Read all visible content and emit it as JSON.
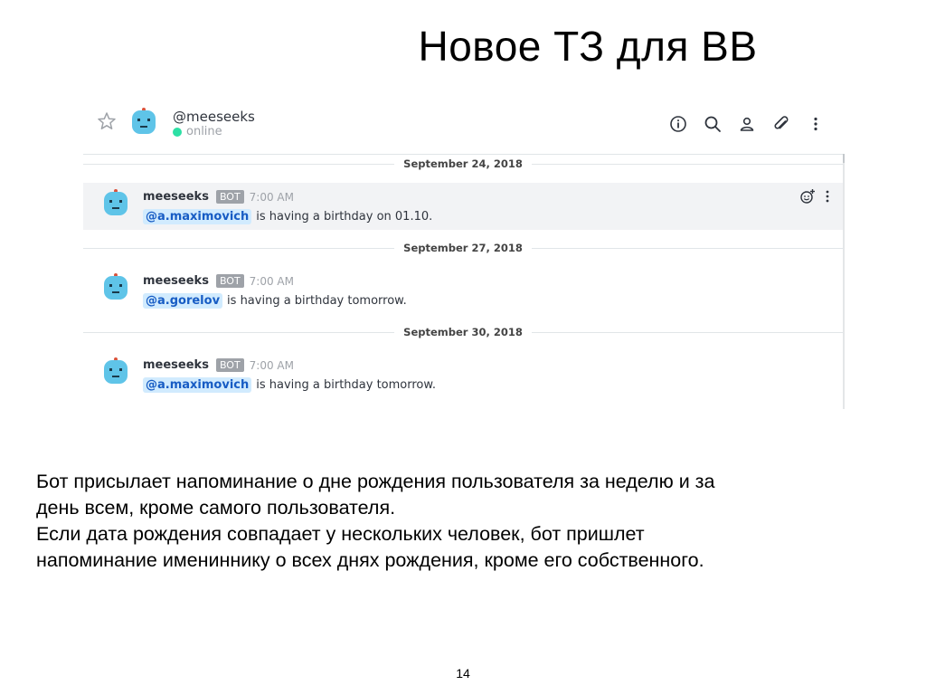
{
  "slide": {
    "title": "Новое ТЗ для ВВ",
    "caption_lines": [
      "Бот присылает напоминание о дне рождения пользователя за неделю и за",
      "день всем, кроме самого пользователя.",
      "Если дата рождения совпадает у нескольких человек, бот пришлет",
      "напоминание имениннику о всех днях рождения, кроме его собственного."
    ],
    "page_number": "14"
  },
  "chat": {
    "header": {
      "room_name": "@meeseeks",
      "status": "online",
      "status_color": "#2de0a5",
      "icons": [
        "star-icon",
        "info-icon",
        "search-icon",
        "user-icon",
        "attachment-icon",
        "kebab-menu-icon"
      ]
    },
    "messages": [
      {
        "date": "September 24, 2018",
        "user": "meeseeks",
        "badge": "BOT",
        "time": "7:00 AM",
        "mention": "@a.maximovich",
        "text": "is having a birthday on 01.10.",
        "hovered": true
      },
      {
        "date": "September 27, 2018",
        "user": "meeseeks",
        "badge": "BOT",
        "time": "7:00 AM",
        "mention": "@a.gorelov",
        "text": "is having a birthday tomorrow.",
        "hovered": false
      },
      {
        "date": "September 30, 2018",
        "user": "meeseeks",
        "badge": "BOT",
        "time": "7:00 AM",
        "mention": "@a.maximovich",
        "text": "is having a birthday tomorrow.",
        "hovered": false
      }
    ],
    "colors": {
      "avatar": "#5fc4e8",
      "mention_bg": "#d1ebfe",
      "mention_text": "#175cc4",
      "bot_badge": "#9ea2a8"
    }
  }
}
